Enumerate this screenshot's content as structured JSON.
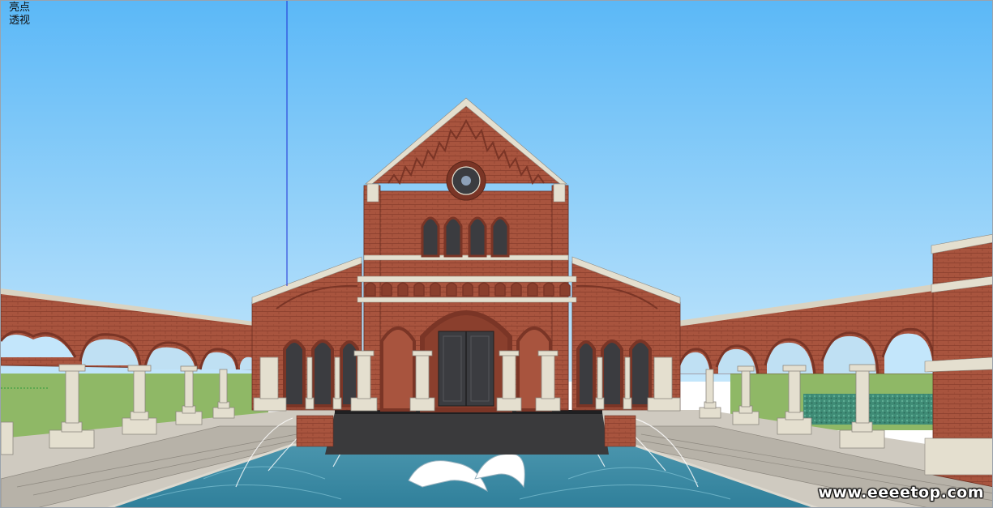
{
  "viewport": {
    "style_label": "亮点",
    "camera_label": "透视"
  },
  "watermark": {
    "text": "www.eeeetop.com"
  },
  "scene": {
    "sky_top": "#5bb8f7",
    "sky_bottom": "#bfe4fb",
    "brick": "#a8543e",
    "brick_dark": "#7a3526",
    "stone": "#dcd6c4",
    "water": "#4f9fb7",
    "lawn": "#8fb866",
    "axis_blue": "#1c2fd6"
  }
}
